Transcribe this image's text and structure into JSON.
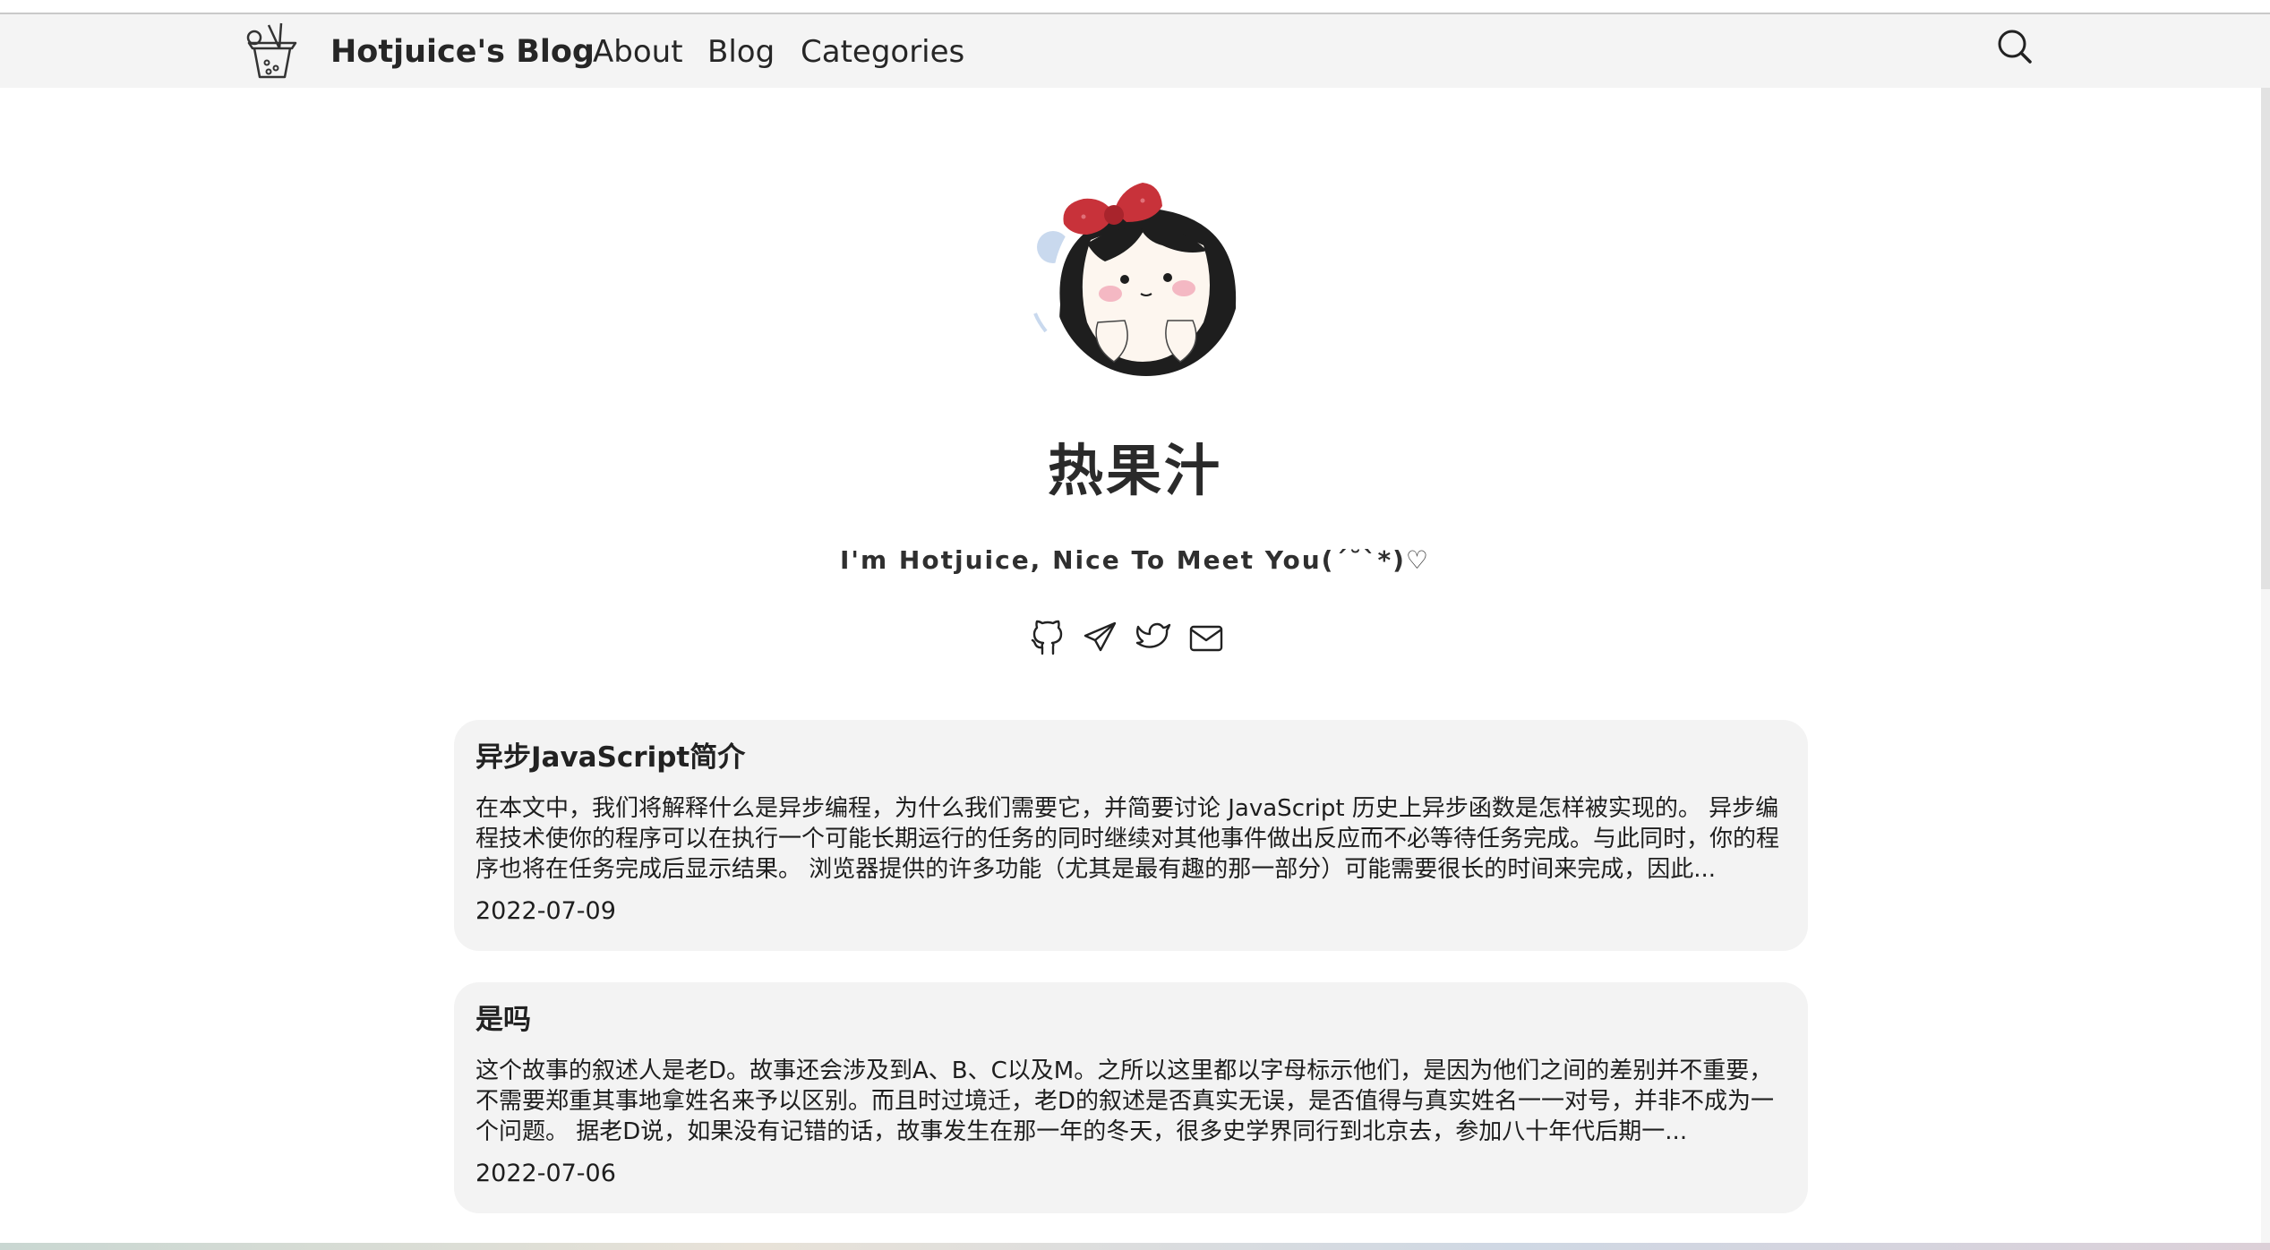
{
  "header": {
    "site_title": "Hotjuice's Blog",
    "nav": [
      {
        "label": "About"
      },
      {
        "label": "Blog"
      },
      {
        "label": "Categories"
      }
    ]
  },
  "profile": {
    "name": "热果汁",
    "tagline": "I'm Hotjuice, Nice To Meet You(´˘`*)♡",
    "socials": [
      "github-icon",
      "telegram-icon",
      "twitter-icon",
      "mail-icon"
    ]
  },
  "posts": [
    {
      "title": "异步JavaScript简介",
      "excerpt": "在本文中，我们将解释什么是异步编程，为什么我们需要它，并简要讨论 JavaScript 历史上异步函数是怎样被实现的。 异步编程技术使你的程序可以在执行一个可能长期运行的任务的同时继续对其他事件做出反应而不必等待任务完成。与此同时，你的程序也将在任务完成后显示结果。 浏览器提供的许多功能（尤其是最有趣的那一部分）可能需要很长的时间来完成，因此...",
      "date": "2022-07-09"
    },
    {
      "title": "是吗",
      "excerpt": "这个故事的叙述人是老D。故事还会涉及到A、B、C以及M。之所以这里都以字母标示他们，是因为他们之间的差别并不重要，不需要郑重其事地拿姓名来予以区别。而且时过境迁，老D的叙述是否真实无误，是否值得与真实姓名一一对号，并非不成为一个问题。 据老D说，如果没有记错的话，故事发生在那一年的冬天，很多史学界同行到北京去，参加八十年代后期一...",
      "date": "2022-07-06"
    }
  ],
  "colors": {
    "navbar_bg": "#f4f4f4",
    "card_bg": "#f3f3f3",
    "bow_red": "#c8323a",
    "text_dark": "#1f1f1f"
  }
}
